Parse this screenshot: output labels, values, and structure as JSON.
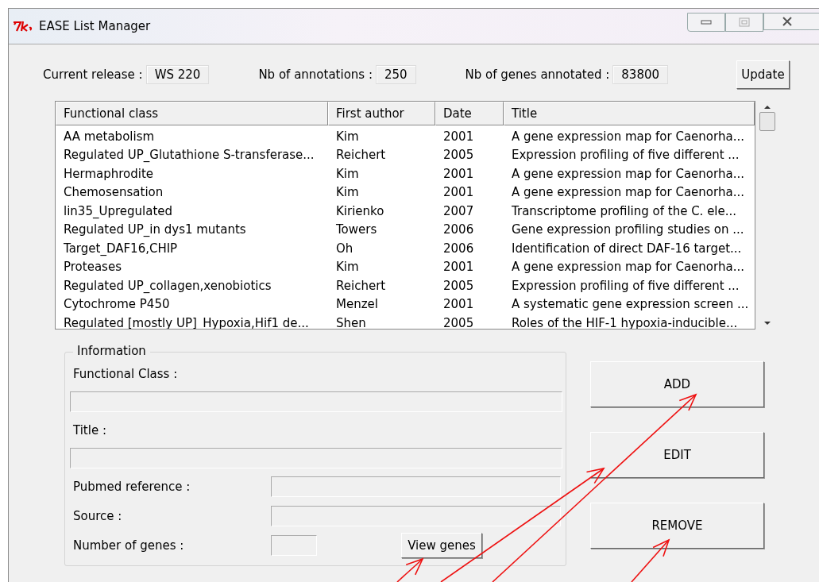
{
  "window": {
    "title": "EASE List Manager"
  },
  "header": {
    "fields": [
      {
        "label": "Current release :",
        "value": "WS 220"
      },
      {
        "label": "Nb of annotations :",
        "value": "250"
      },
      {
        "label": "Nb of genes annotated :",
        "value": "83800"
      }
    ],
    "update_button": "Update"
  },
  "table": {
    "columns": [
      "Functional class",
      "First author",
      "Date",
      "Title"
    ],
    "rows": [
      [
        "AA metabolism",
        "Kim",
        "2001",
        "A gene expression map for Caenorha..."
      ],
      [
        "Regulated UP_Glutathione S-transferase...",
        "Reichert",
        "2005",
        "Expression profiling of five different ..."
      ],
      [
        "Hermaphrodite",
        "Kim",
        "2001",
        "A gene expression map for Caenorha..."
      ],
      [
        "Chemosensation",
        "Kim",
        "2001",
        "A gene expression map for Caenorha..."
      ],
      [
        "lin35_Upregulated",
        "Kirienko",
        "2007",
        "Transcriptome profiling of the C. ele..."
      ],
      [
        "Regulated UP_in dys1 mutants",
        "Towers",
        "2006",
        "Gene expression profiling studies on ..."
      ],
      [
        "Target_DAF16,CHIP",
        "Oh",
        "2006",
        "Identification of direct DAF-16 target..."
      ],
      [
        "Proteases",
        "Kim",
        "2001",
        "A gene expression map for Caenorha..."
      ],
      [
        "Regulated UP_collagen,xenobiotics",
        "Reichert",
        "2005",
        "Expression profiling of five different ..."
      ],
      [
        "Cytochrome P450",
        "Menzel",
        "2001",
        "A systematic gene expression screen ..."
      ],
      [
        "Regulated [mostly UP]_Hypoxia,Hif1 de...",
        "Shen",
        "2005",
        "Roles of the HIF-1 hypoxia-inducible..."
      ]
    ]
  },
  "information": {
    "title": "Information",
    "functional_class_label": "Functional Class :",
    "title_label": "Title :",
    "pubmed_label": "Pubmed reference :",
    "source_label": "Source :",
    "genes_label": "Number of genes :",
    "view_genes_button": "View genes"
  },
  "actions": [
    "ADD",
    "EDIT",
    "REMOVE"
  ]
}
